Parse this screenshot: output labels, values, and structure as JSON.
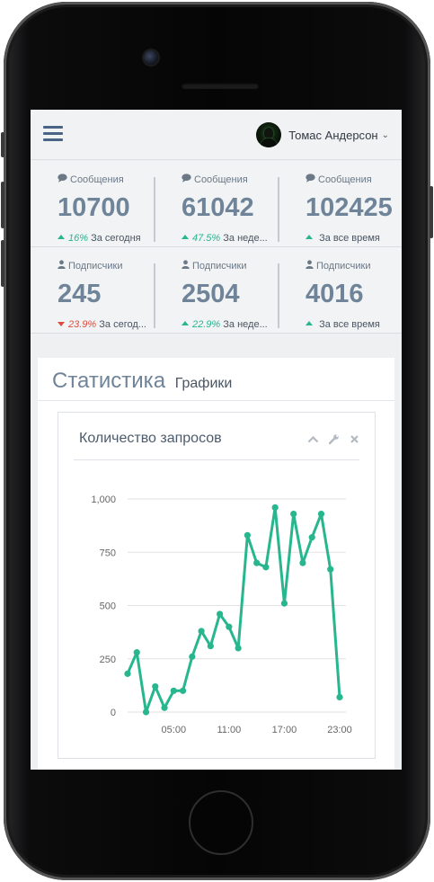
{
  "header": {
    "user_name": "Томас Андерсон"
  },
  "stats": [
    [
      {
        "icon": "comment-icon",
        "label": "Сообщения",
        "value": "10700",
        "trend_dir": "up",
        "trend_pct": "16%",
        "trend_text": "За сегодня"
      },
      {
        "icon": "comment-icon",
        "label": "Сообщения",
        "value": "61042",
        "trend_dir": "up",
        "trend_pct": "47.5%",
        "trend_text": "За неде..."
      },
      {
        "icon": "comment-icon",
        "label": "Сообщения",
        "value": "102425",
        "trend_dir": "up",
        "trend_pct": "",
        "trend_text": "За все время"
      }
    ],
    [
      {
        "icon": "user-icon",
        "label": "Подписчики",
        "value": "245",
        "trend_dir": "down",
        "trend_pct": "23.9%",
        "trend_text": "За сегод..."
      },
      {
        "icon": "user-icon",
        "label": "Подписчики",
        "value": "2504",
        "trend_dir": "up",
        "trend_pct": "22.9%",
        "trend_text": "За неде..."
      },
      {
        "icon": "user-icon",
        "label": "Подписчики",
        "value": "4016",
        "trend_dir": "up",
        "trend_pct": "",
        "trend_text": "За все время"
      }
    ]
  ],
  "section": {
    "title": "Статистика",
    "subtitle": "Графики"
  },
  "widget": {
    "title": "Количество запросов"
  },
  "colors": {
    "accent": "#27b68d",
    "negative": "#dd4b39",
    "value": "#6f8499"
  },
  "chart_data": {
    "type": "line",
    "title": "Количество запросов",
    "xlabel": "",
    "ylabel": "",
    "ylim": [
      0,
      1000
    ],
    "y_ticks": [
      "0",
      "250",
      "500",
      "750",
      "1,000"
    ],
    "x_tick_labels": [
      "05:00",
      "11:00",
      "17:00",
      "23:00"
    ],
    "x_ticks_hours": [
      5,
      11,
      17,
      23
    ],
    "grid": true,
    "series": [
      {
        "x": [
          0,
          1,
          2,
          3,
          4,
          5,
          6,
          7,
          8,
          9,
          10,
          11,
          12,
          13,
          14,
          15,
          16,
          17,
          18,
          19,
          20,
          21,
          22,
          23
        ],
        "values": [
          180,
          280,
          0,
          120,
          20,
          100,
          100,
          260,
          380,
          310,
          460,
          400,
          300,
          830,
          700,
          680,
          960,
          510,
          930,
          700,
          820,
          930,
          670,
          70
        ]
      }
    ]
  }
}
